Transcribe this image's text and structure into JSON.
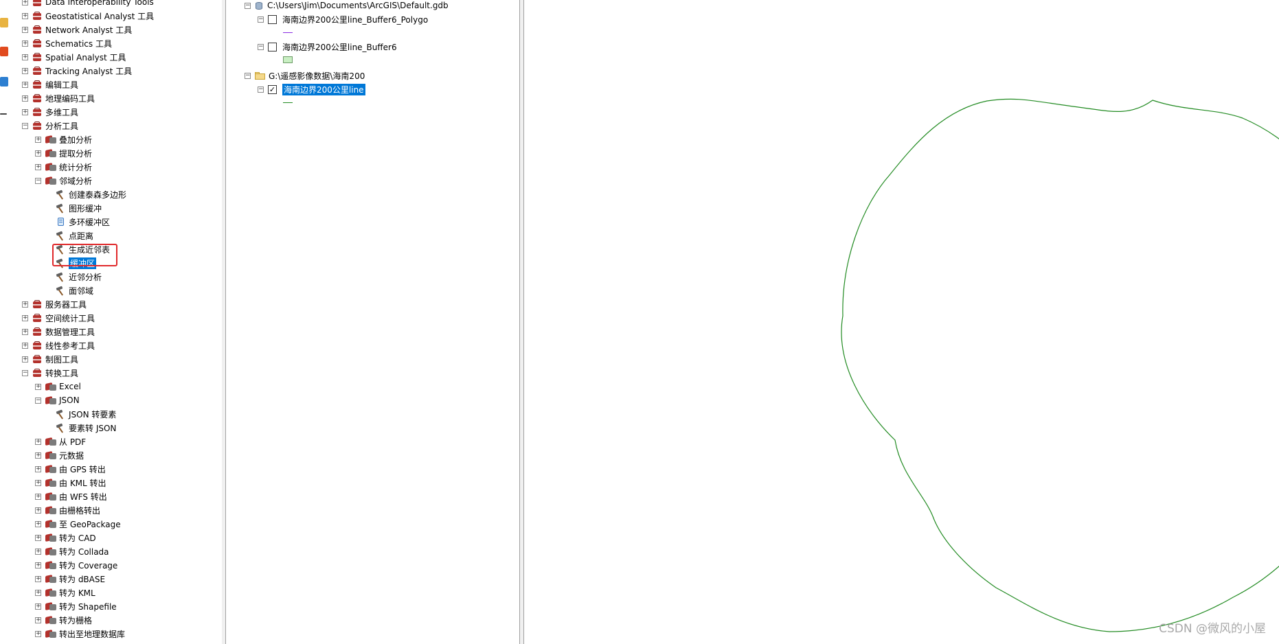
{
  "colors": {
    "toolbox_red": "#b3312c",
    "selection_blue": "#0078d7",
    "highlight_red": "#e0282a",
    "buffer_line_green": "#228b22",
    "polygon_fill": "#c9efc3"
  },
  "toolbox": {
    "items": [
      {
        "label": "Data Interoperability Tools",
        "type": "toolbox",
        "expander": "+"
      },
      {
        "label": "Geostatistical Analyst 工具",
        "type": "toolbox",
        "expander": "+"
      },
      {
        "label": "Network Analyst 工具",
        "type": "toolbox",
        "expander": "+"
      },
      {
        "label": "Schematics 工具",
        "type": "toolbox",
        "expander": "+"
      },
      {
        "label": "Spatial Analyst 工具",
        "type": "toolbox",
        "expander": "+"
      },
      {
        "label": "Tracking Analyst 工具",
        "type": "toolbox",
        "expander": "+"
      },
      {
        "label": "编辑工具",
        "type": "toolbox",
        "expander": "+"
      },
      {
        "label": "地理编码工具",
        "type": "toolbox",
        "expander": "+"
      },
      {
        "label": "多维工具",
        "type": "toolbox",
        "expander": "+"
      },
      {
        "label": "分析工具",
        "type": "toolbox",
        "expander": "−"
      },
      {
        "label": "叠加分析",
        "type": "toolset",
        "expander": "+"
      },
      {
        "label": "提取分析",
        "type": "toolset",
        "expander": "+"
      },
      {
        "label": "统计分析",
        "type": "toolset",
        "expander": "+"
      },
      {
        "label": "邻域分析",
        "type": "toolset",
        "expander": "−"
      },
      {
        "label": "创建泰森多边形",
        "type": "tool"
      },
      {
        "label": "图形缓冲",
        "type": "tool"
      },
      {
        "label": "多环缓冲区",
        "type": "script"
      },
      {
        "label": "点距离",
        "type": "tool"
      },
      {
        "label": "生成近邻表",
        "type": "tool"
      },
      {
        "label": "缓冲区",
        "type": "tool",
        "selected": true
      },
      {
        "label": "近邻分析",
        "type": "tool"
      },
      {
        "label": "面邻域",
        "type": "tool"
      },
      {
        "label": "服务器工具",
        "type": "toolbox",
        "expander": "+"
      },
      {
        "label": "空间统计工具",
        "type": "toolbox",
        "expander": "+"
      },
      {
        "label": "数据管理工具",
        "type": "toolbox",
        "expander": "+"
      },
      {
        "label": "线性参考工具",
        "type": "toolbox",
        "expander": "+"
      },
      {
        "label": "制图工具",
        "type": "toolbox",
        "expander": "+"
      },
      {
        "label": "转换工具",
        "type": "toolbox",
        "expander": "−"
      },
      {
        "label": "Excel",
        "type": "toolset",
        "expander": "+"
      },
      {
        "label": "JSON",
        "type": "toolset",
        "expander": "−"
      },
      {
        "label": "JSON 转要素",
        "type": "tool"
      },
      {
        "label": "要素转 JSON",
        "type": "tool"
      },
      {
        "label": "从 PDF",
        "type": "toolset",
        "expander": "+"
      },
      {
        "label": "元数据",
        "type": "toolset",
        "expander": "+"
      },
      {
        "label": "由 GPS 转出",
        "type": "toolset",
        "expander": "+"
      },
      {
        "label": "由 KML 转出",
        "type": "toolset",
        "expander": "+"
      },
      {
        "label": "由 WFS 转出",
        "type": "toolset",
        "expander": "+"
      },
      {
        "label": "由栅格转出",
        "type": "toolset",
        "expander": "+"
      },
      {
        "label": "至 GeoPackage",
        "type": "toolset",
        "expander": "+"
      },
      {
        "label": "转为 CAD",
        "type": "toolset",
        "expander": "+"
      },
      {
        "label": "转为 Collada",
        "type": "toolset",
        "expander": "+"
      },
      {
        "label": "转为 Coverage",
        "type": "toolset",
        "expander": "+"
      },
      {
        "label": "转为 dBASE",
        "type": "toolset",
        "expander": "+"
      },
      {
        "label": "转为 KML",
        "type": "toolset",
        "expander": "+"
      },
      {
        "label": "转为 Shapefile",
        "type": "toolset",
        "expander": "+"
      },
      {
        "label": "转为栅格",
        "type": "toolset",
        "expander": "+"
      },
      {
        "label": "转出至地理数据库",
        "type": "toolset",
        "expander": "+"
      }
    ]
  },
  "toc": {
    "groups": [
      {
        "path": "C:\\Users\\Jim\\Documents\\ArcGIS\\Default.gdb",
        "icon": "geodatabase-icon",
        "layers": [
          {
            "name": "海南边界200公里line_Buffer6_Polygo",
            "checked": false,
            "symbol": "line",
            "symbol_color": "#8a2be2"
          },
          {
            "name": "海南边界200公里line_Buffer6",
            "checked": false,
            "symbol": "polygon",
            "symbol_color": "#c9efc3"
          }
        ]
      },
      {
        "path": "G:\\遥感影像数据\\海南200",
        "icon": "folder-icon",
        "layers": [
          {
            "name": "海南边界200公里line",
            "checked": true,
            "selected": true,
            "symbol": "line",
            "symbol_color": "#228b22"
          }
        ]
      }
    ]
  },
  "watermark": "CSDN @微风的小屋"
}
